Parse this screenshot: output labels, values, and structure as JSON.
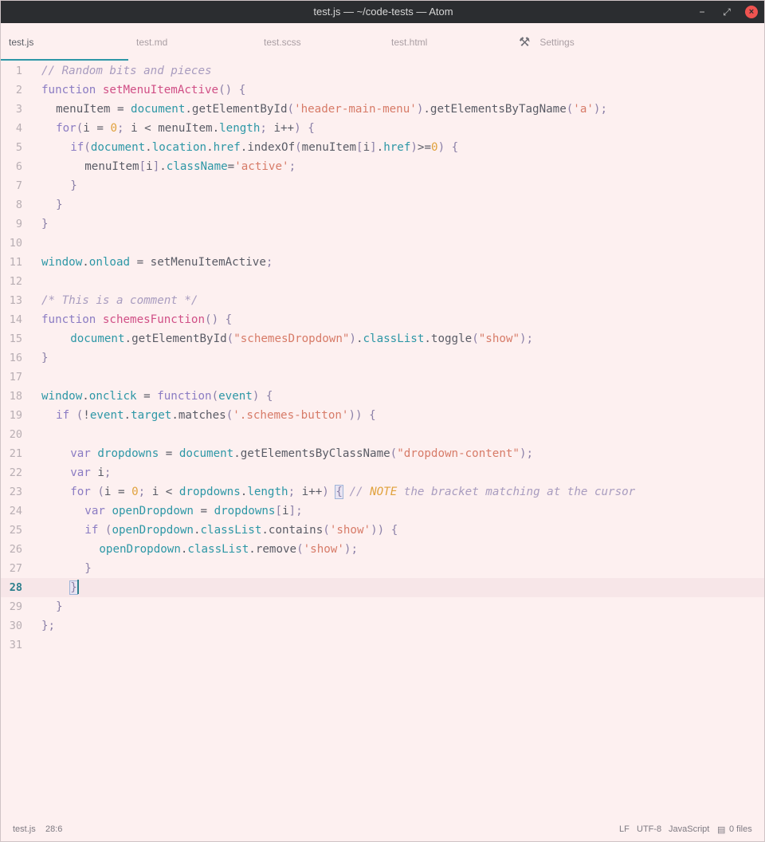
{
  "window": {
    "title": "test.js — ~/code-tests — Atom",
    "controls": {
      "minimize": "−",
      "restore": "⤢",
      "close": "×"
    }
  },
  "tabs": [
    {
      "label": "test.js",
      "active": true
    },
    {
      "label": "test.md",
      "active": false
    },
    {
      "label": "test.scss",
      "active": false
    },
    {
      "label": "test.html",
      "active": false
    },
    {
      "label": "Settings",
      "active": false,
      "icon": "tools-icon"
    }
  ],
  "editor": {
    "language": "JavaScript",
    "cursor_line": 28,
    "line_numbers": [
      "1",
      "2",
      "3",
      "4",
      "5",
      "6",
      "7",
      "8",
      "9",
      "10",
      "11",
      "12",
      "13",
      "14",
      "15",
      "16",
      "17",
      "18",
      "19",
      "20",
      "21",
      "22",
      "23",
      "24",
      "25",
      "26",
      "27",
      "28",
      "29",
      "30",
      "31"
    ],
    "lines": [
      "// Random bits and pieces",
      "function setMenuItemActive() {",
      "  menuItem = document.getElementById('header-main-menu').getElementsByTagName('a');",
      "  for(i = 0; i < menuItem.length; i++) {",
      "    if(document.location.href.indexOf(menuItem[i].href)>=0) {",
      "      menuItem[i].className='active';",
      "    }",
      "  }",
      "}",
      "",
      "window.onload = setMenuItemActive;",
      "",
      "/* This is a comment */",
      "function schemesFunction() {",
      "    document.getElementById(\"schemesDropdown\").classList.toggle(\"show\");",
      "}",
      "",
      "window.onclick = function(event) {",
      "  if (!event.target.matches('.schemes-button')) {",
      "",
      "    var dropdowns = document.getElementsByClassName(\"dropdown-content\");",
      "    var i;",
      "    for (i = 0; i < dropdowns.length; i++) { // NOTE the bracket matching at the cursor",
      "      var openDropdown = dropdowns[i];",
      "      if (openDropdown.classList.contains('show')) {",
      "        openDropdown.classList.remove('show');",
      "      }",
      "    }",
      "  }",
      "};",
      ""
    ]
  },
  "status": {
    "file": "test.js",
    "position": "28:6",
    "line_ending": "LF",
    "encoding": "UTF-8",
    "grammar": "JavaScript",
    "git_files": "0 files"
  },
  "colors": {
    "accent": "#2d97a6",
    "keyword": "#8b7cc3",
    "function": "#d04f86",
    "string": "#d77b68",
    "number": "#e0a23d",
    "background": "#fdf0f0"
  }
}
